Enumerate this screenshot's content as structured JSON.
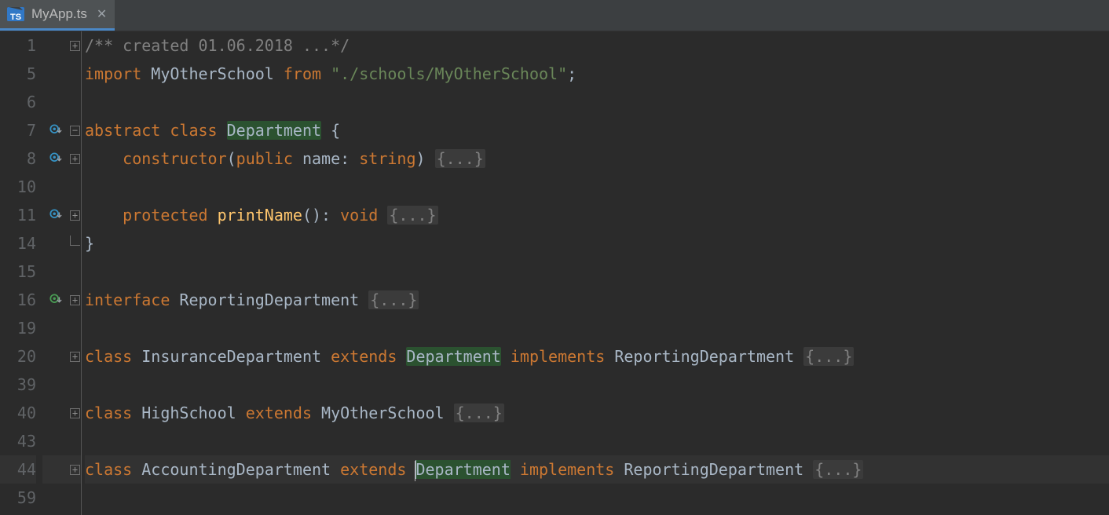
{
  "tab": {
    "filename": "MyApp.ts",
    "filetype_badge": "TS"
  },
  "gutter_icons": {
    "override": "override-down-icon",
    "implements": "implements-down-icon"
  },
  "code_rows": [
    {
      "n": 1,
      "fold": "plus",
      "mark": null,
      "tokens": [
        {
          "c": "cmt",
          "t": "/** created 01.06.2018 ...*/"
        }
      ]
    },
    {
      "n": 5,
      "fold": null,
      "mark": null,
      "tokens": [
        {
          "c": "kw",
          "t": "import "
        },
        {
          "c": "id",
          "t": "MyOtherSchool "
        },
        {
          "c": "kw",
          "t": "from "
        },
        {
          "c": "str",
          "t": "\"./schools/MyOtherSchool\""
        },
        {
          "c": "punc",
          "t": ";"
        }
      ]
    },
    {
      "n": 6,
      "fold": null,
      "mark": null,
      "tokens": []
    },
    {
      "n": 7,
      "fold": "minus",
      "mark": "override",
      "tokens": [
        {
          "c": "kw",
          "t": "abstract class "
        },
        {
          "c": "id usage",
          "t": "Department"
        },
        {
          "c": "punc",
          "t": " {"
        }
      ]
    },
    {
      "n": 8,
      "fold": "plus",
      "mark": "override",
      "indent": 1,
      "tokens": [
        {
          "c": "kw",
          "t": "constructor"
        },
        {
          "c": "punc",
          "t": "("
        },
        {
          "c": "kw",
          "t": "public "
        },
        {
          "c": "param",
          "t": "name"
        },
        {
          "c": "punc",
          "t": ": "
        },
        {
          "c": "kw",
          "t": "string"
        },
        {
          "c": "punc",
          "t": ") "
        },
        {
          "c": "folded",
          "t": "{...}"
        }
      ]
    },
    {
      "n": 10,
      "fold": null,
      "mark": null,
      "tokens": []
    },
    {
      "n": 11,
      "fold": "plus",
      "mark": "override",
      "indent": 1,
      "tokens": [
        {
          "c": "kw",
          "t": "protected "
        },
        {
          "c": "fn",
          "t": "printName"
        },
        {
          "c": "punc",
          "t": "(): "
        },
        {
          "c": "kw",
          "t": "void "
        },
        {
          "c": "folded",
          "t": "{...}"
        }
      ]
    },
    {
      "n": 14,
      "fold": "end",
      "mark": null,
      "tokens": [
        {
          "c": "punc",
          "t": "}"
        }
      ]
    },
    {
      "n": 15,
      "fold": null,
      "mark": null,
      "tokens": []
    },
    {
      "n": 16,
      "fold": "plus",
      "mark": "implements",
      "tokens": [
        {
          "c": "kw",
          "t": "interface "
        },
        {
          "c": "id",
          "t": "ReportingDepartment "
        },
        {
          "c": "folded",
          "t": "{...}"
        }
      ]
    },
    {
      "n": 19,
      "fold": null,
      "mark": null,
      "tokens": []
    },
    {
      "n": 20,
      "fold": "plus",
      "mark": null,
      "tokens": [
        {
          "c": "kw",
          "t": "class "
        },
        {
          "c": "id",
          "t": "InsuranceDepartment "
        },
        {
          "c": "kw",
          "t": "extends "
        },
        {
          "c": "id usage",
          "t": "Department"
        },
        {
          "c": "kw",
          "t": " implements "
        },
        {
          "c": "id",
          "t": "ReportingDepartment "
        },
        {
          "c": "folded",
          "t": "{...}"
        }
      ]
    },
    {
      "n": 39,
      "fold": null,
      "mark": null,
      "tokens": []
    },
    {
      "n": 40,
      "fold": "plus",
      "mark": null,
      "tokens": [
        {
          "c": "kw",
          "t": "class "
        },
        {
          "c": "id",
          "t": "HighSchool "
        },
        {
          "c": "kw",
          "t": "extends "
        },
        {
          "c": "id",
          "t": "MyOtherSchool "
        },
        {
          "c": "folded",
          "t": "{...}"
        }
      ]
    },
    {
      "n": 43,
      "fold": null,
      "mark": null,
      "tokens": []
    },
    {
      "n": 44,
      "fold": "plus",
      "mark": null,
      "current": true,
      "tokens": [
        {
          "c": "kw",
          "t": "class "
        },
        {
          "c": "id",
          "t": "AccountingDepartment "
        },
        {
          "c": "kw",
          "t": "extends "
        },
        {
          "c": "id usage-cur",
          "t": "Department",
          "caret": true
        },
        {
          "c": "kw",
          "t": " implements "
        },
        {
          "c": "id",
          "t": "ReportingDepartment "
        },
        {
          "c": "folded",
          "t": "{...}"
        }
      ]
    },
    {
      "n": 59,
      "fold": null,
      "mark": null,
      "tokens": []
    }
  ]
}
